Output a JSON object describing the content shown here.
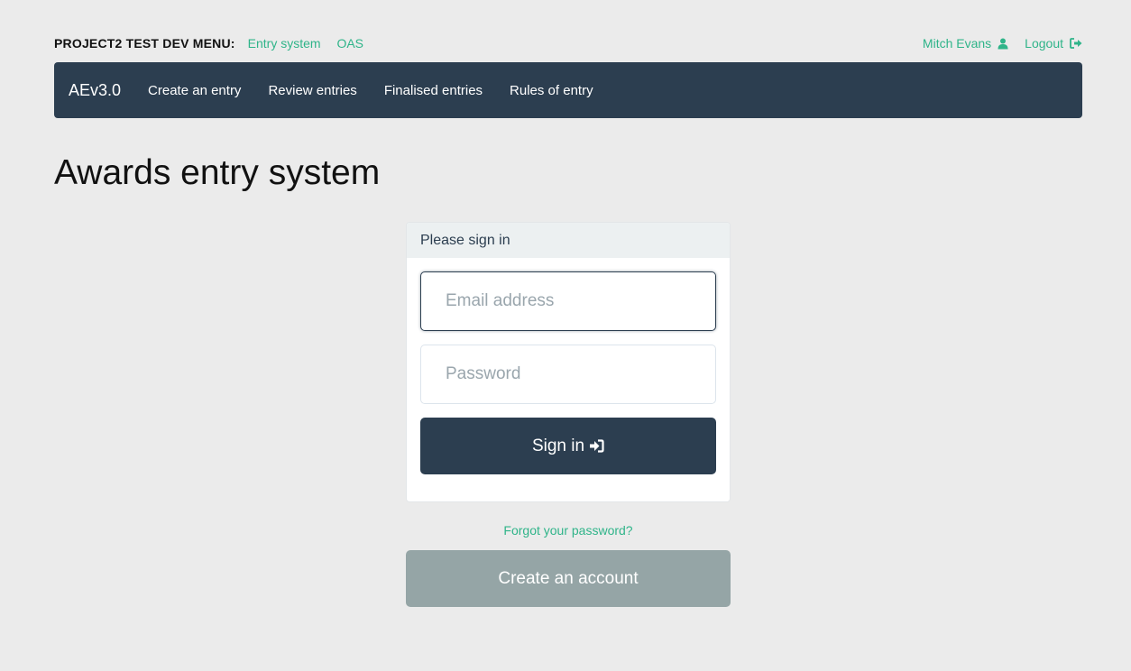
{
  "devbar": {
    "title": "PROJECT2 TEST DEV MENU:",
    "links": [
      {
        "label": "Entry system"
      },
      {
        "label": "OAS"
      }
    ],
    "user": {
      "name": "Mitch Evans",
      "icon": "user-icon"
    },
    "logout": {
      "label": "Logout",
      "icon": "sign-out-icon"
    },
    "link_color": "#2fb489"
  },
  "navbar": {
    "brand": "AEv3.0",
    "items": [
      {
        "label": "Create an entry"
      },
      {
        "label": "Review entries"
      },
      {
        "label": "Finalised entries"
      },
      {
        "label": "Rules of entry"
      }
    ],
    "background": "#2c3e50"
  },
  "page": {
    "title": "Awards entry system"
  },
  "signin": {
    "heading": "Please sign in",
    "email_placeholder": "Email address",
    "email_value": "",
    "password_placeholder": "Password",
    "password_value": "",
    "button_label": "Sign in",
    "button_icon": "sign-in-icon"
  },
  "forgot_password": "Forgot your password?",
  "create_account": "Create an account"
}
